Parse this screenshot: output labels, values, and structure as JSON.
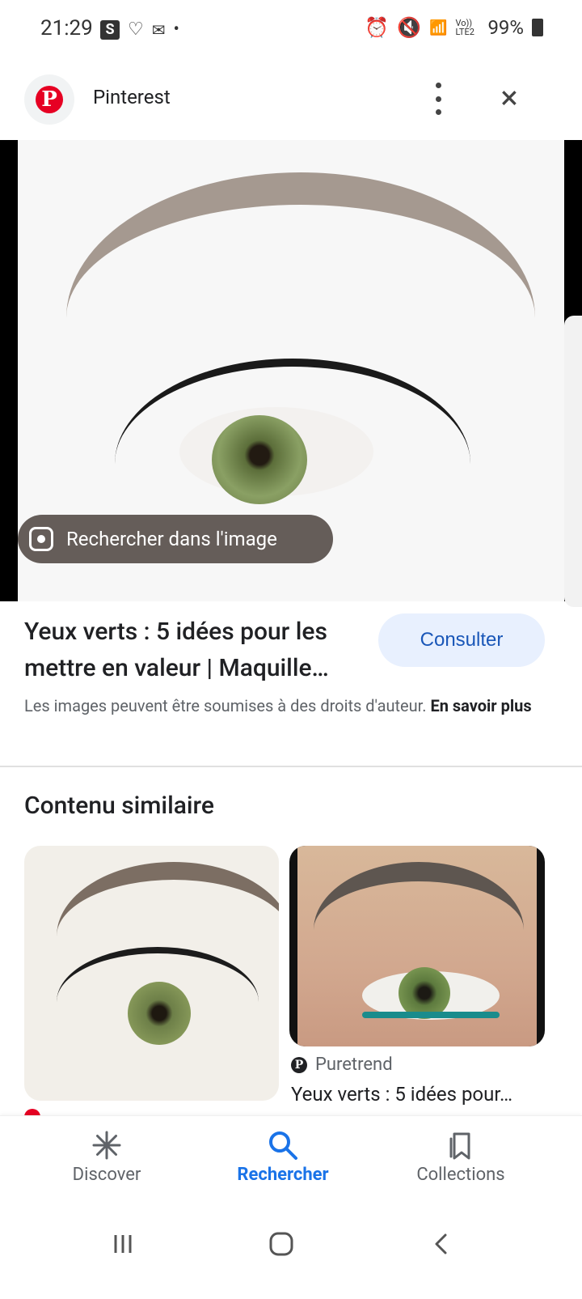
{
  "status_bar": {
    "time": "21:29",
    "s_badge": "S",
    "battery": "99%",
    "network": "Vo)) LTE2"
  },
  "header": {
    "site_name": "Pinterest"
  },
  "hero": {
    "search_chip_label": "Rechercher dans l'image"
  },
  "result": {
    "title": "Yeux verts : 5 idées pour les mettre en valeur | Maquille…",
    "consult_label": "Consulter",
    "copyright_text": "Les images peuvent être soumises à des droits d'auteur.",
    "learn_more": "En savoir plus"
  },
  "similar": {
    "section_title": "Contenu similaire",
    "cards": [
      {
        "source": "",
        "title": ""
      },
      {
        "source": "Puretrend",
        "title": "Yeux verts : 5 idées pour…"
      }
    ]
  },
  "bottom_nav": {
    "items": [
      {
        "label": "Discover",
        "icon": "asterisk-icon",
        "active": false
      },
      {
        "label": "Rechercher",
        "icon": "search-icon",
        "active": true
      },
      {
        "label": "Collections",
        "icon": "bookmarks-icon",
        "active": false
      }
    ]
  },
  "colors": {
    "accent": "#1a73e8",
    "consult_bg": "#e8f0fe",
    "pinterest_red": "#e60023"
  }
}
